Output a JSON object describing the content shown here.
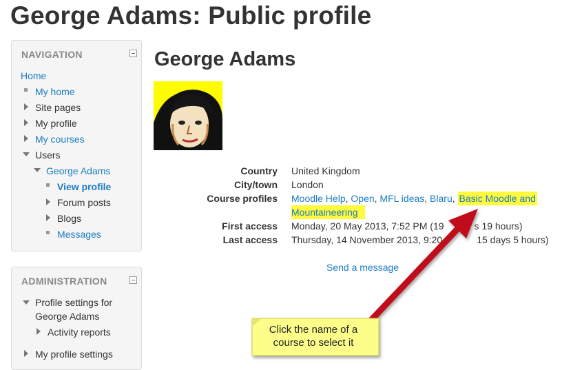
{
  "page": {
    "title": "George Adams: Public profile"
  },
  "navigation": {
    "heading": "NAVIGATION",
    "home": "Home",
    "my_home": "My home",
    "site_pages": "Site pages",
    "my_profile": "My profile",
    "my_courses": "My courses",
    "users": "Users",
    "george_adams": "George Adams",
    "view_profile": "View profile",
    "forum_posts": "Forum posts",
    "blogs": "Blogs",
    "messages": "Messages"
  },
  "administration": {
    "heading": "ADMINISTRATION",
    "profile_settings_line1": "Profile settings for",
    "profile_settings_line2": "George Adams",
    "activity_reports": "Activity reports",
    "my_profile_settings": "My profile settings"
  },
  "profile": {
    "name": "George Adams",
    "country_label": "Country",
    "country": "United Kingdom",
    "city_label": "City/town",
    "city": "London",
    "course_profiles_label": "Course profiles",
    "courses": [
      "Moodle Help",
      "Open",
      "MFL ideas",
      "Blaru"
    ],
    "highlighted_course_line1": "Basic Moodle and",
    "highlighted_course_line2": "Mountaineering",
    "first_access_label": "First access",
    "first_access_a": "Monday, 20 May 2013, 7:52 PM  (19",
    "first_access_b": "s 19 hours)",
    "last_access_label": "Last access",
    "last_access_a": "Thursday, 14 November 2013, 9:20",
    "last_access_b": "15 days 5 hours)",
    "send_message": "Send a message"
  },
  "callout": {
    "line1": "Click the name of a",
    "line2": "course to select it"
  },
  "colors": {
    "link": "#1a7cc3",
    "highlight": "#fffa3c",
    "arrow": "#c0101a",
    "callout": "#fdfd8a"
  }
}
